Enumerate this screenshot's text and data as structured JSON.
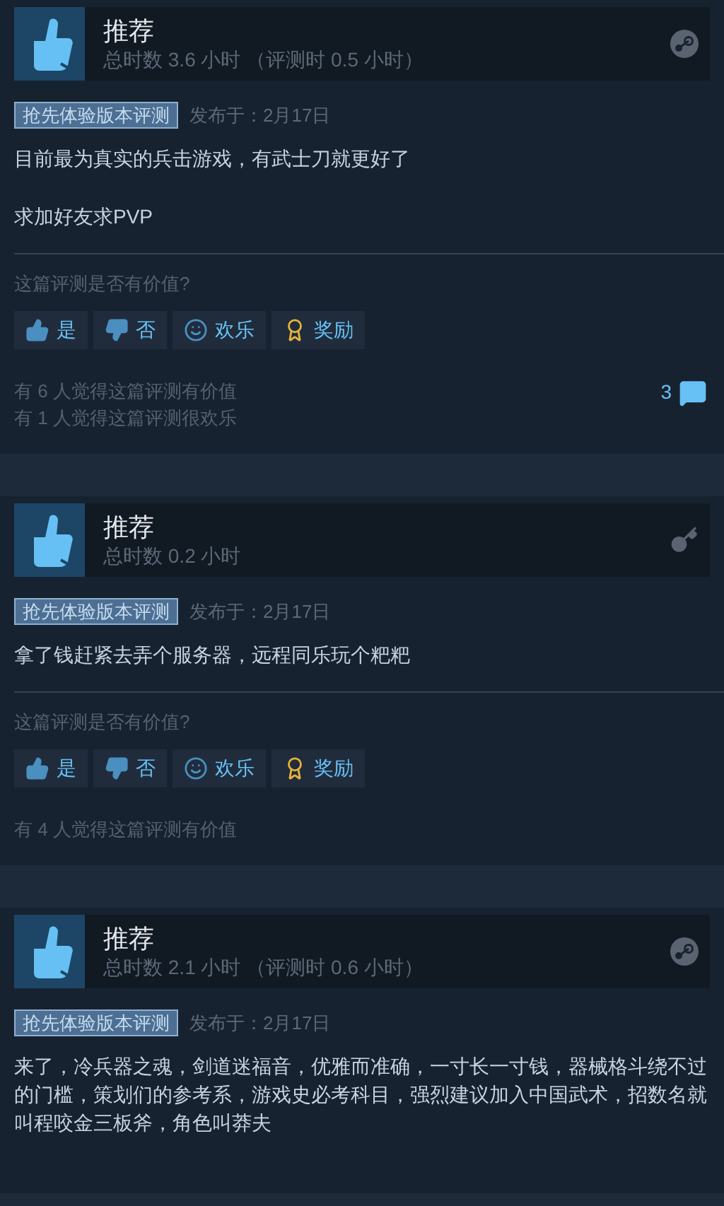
{
  "reviews": [
    {
      "title": "推荐",
      "hours": "总时数 3.6 小时 （评测时 0.5 小时）",
      "kind": "steam",
      "tag": "抢先体验版本评测",
      "date": "发布于：2月17日",
      "paragraphs": [
        "目前最为真实的兵击游戏，有武士刀就更好了",
        "求加好友求PVP"
      ],
      "question": "这篇评测是否有价值?",
      "buttons": [
        {
          "kind": "yes",
          "label": "是"
        },
        {
          "kind": "no",
          "label": "否"
        },
        {
          "kind": "funny",
          "label": "欢乐"
        },
        {
          "kind": "award",
          "label": "奖励"
        }
      ],
      "stats": [
        "有 6 人觉得这篇评测有价值",
        "有 1 人觉得这篇评测很欢乐"
      ],
      "comments": "3"
    },
    {
      "title": "推荐",
      "hours": "总时数 0.2 小时",
      "kind": "key",
      "tag": "抢先体验版本评测",
      "date": "发布于：2月17日",
      "paragraphs": [
        "拿了钱赶紧去弄个服务器，远程同乐玩个粑粑"
      ],
      "question": "这篇评测是否有价值?",
      "buttons": [
        {
          "kind": "yes",
          "label": "是"
        },
        {
          "kind": "no",
          "label": "否"
        },
        {
          "kind": "funny",
          "label": "欢乐"
        },
        {
          "kind": "award",
          "label": "奖励"
        }
      ],
      "stats": [
        "有 4 人觉得这篇评测有价值"
      ]
    },
    {
      "title": "推荐",
      "hours": "总时数 2.1 小时 （评测时 0.6 小时）",
      "kind": "steam",
      "tag": "抢先体验版本评测",
      "date": "发布于：2月17日",
      "paragraphs": [
        "来了，冷兵器之魂，剑道迷福音，优雅而准确，一寸长一寸钱，器械格斗绕不过的门槛，策划们的参考系，游戏史必考科目，强烈建议加入中国武术，招数名就叫程咬金三板斧，角色叫莽夫"
      ]
    }
  ]
}
